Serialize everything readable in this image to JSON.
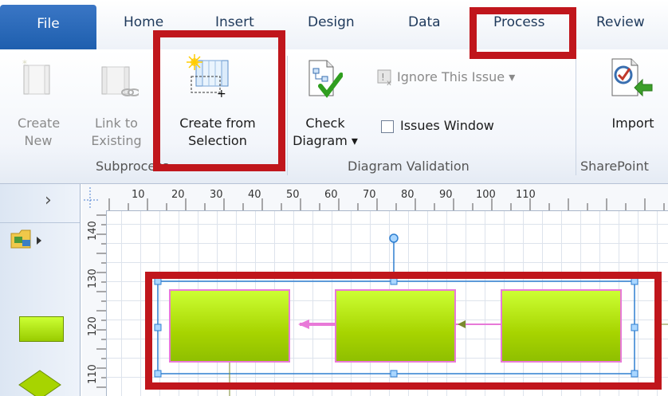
{
  "tabs": {
    "file": "File",
    "home": "Home",
    "insert": "Insert",
    "design": "Design",
    "data": "Data",
    "process": "Process",
    "review": "Review"
  },
  "ribbon": {
    "create_new": [
      "Create",
      "New"
    ],
    "link_to_existing": [
      "Link to",
      "Existing"
    ],
    "create_from_selection": [
      "Create from",
      "Selection"
    ],
    "check_diagram": [
      "Check",
      "Diagram ▾"
    ],
    "ignore_issue": "Ignore This Issue ▾",
    "issues_window": "Issues Window",
    "import": "Import",
    "groups": {
      "subprocess": "Subprocess",
      "diagram_validation": "Diagram Validation",
      "sharepoint": "SharePoint"
    }
  },
  "left_panel": {
    "collapse_arrow": "›"
  },
  "ruler": {
    "h_ticks": [
      "10",
      "20",
      "30",
      "40",
      "50",
      "60",
      "70",
      "80",
      "90",
      "100",
      "110"
    ],
    "v_ticks": [
      "140",
      "130",
      "120",
      "110"
    ]
  },
  "colors": {
    "highlight": "#c0161c",
    "shape_fill": "#a7d400",
    "connector": "#e879d8"
  }
}
